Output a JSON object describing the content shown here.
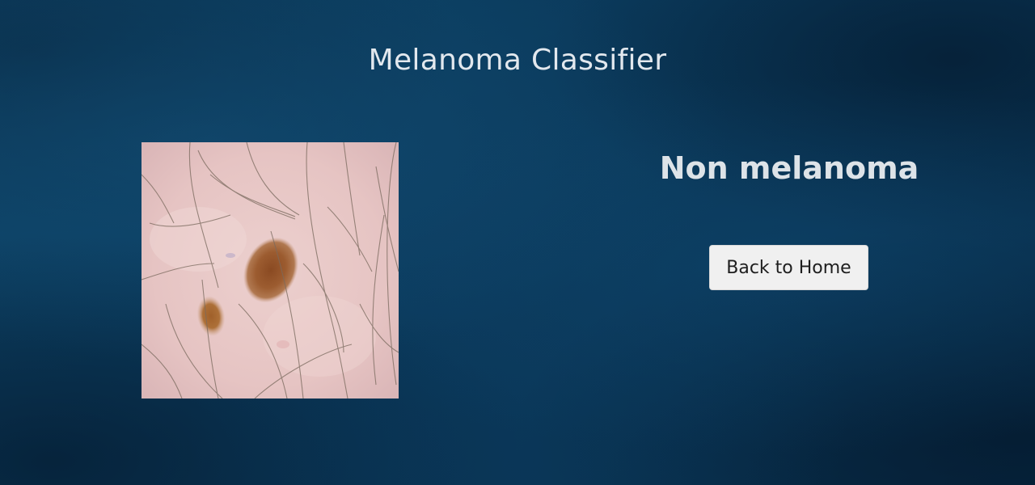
{
  "page": {
    "title": "Melanoma Classifier"
  },
  "result": {
    "label": "Non melanoma"
  },
  "actions": {
    "back_label": "Back to Home"
  },
  "image": {
    "alt": "Uploaded skin lesion image"
  },
  "colors": {
    "background": "#0b3a5c",
    "text": "#e2e8ee",
    "button_bg": "#f0f0f0",
    "skin": "#e8c6c4",
    "mole": "#9a5a2e"
  }
}
